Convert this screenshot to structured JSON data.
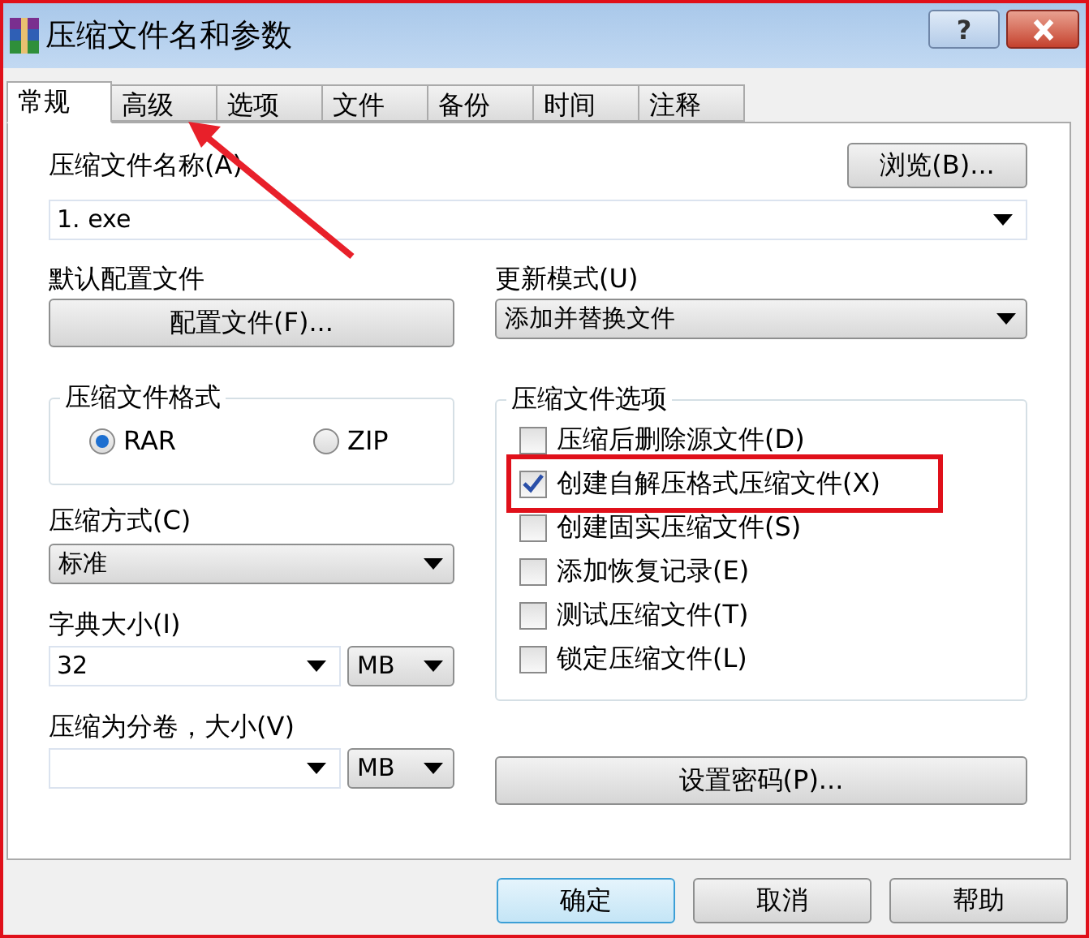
{
  "window": {
    "title": "压缩文件名和参数",
    "help_button": "?"
  },
  "tabs": [
    {
      "label": "常规",
      "selected": true
    },
    {
      "label": "高级",
      "selected": false
    },
    {
      "label": "选项",
      "selected": false
    },
    {
      "label": "文件",
      "selected": false
    },
    {
      "label": "备份",
      "selected": false
    },
    {
      "label": "时间",
      "selected": false
    },
    {
      "label": "注释",
      "selected": false
    }
  ],
  "archive_name": {
    "label": "压缩文件名称(A)",
    "value": "1. exe",
    "browse_button": "浏览(B)..."
  },
  "profiles": {
    "label": "默认配置文件",
    "button": "配置文件(F)..."
  },
  "update_mode": {
    "label": "更新模式(U)",
    "value": "添加并替换文件"
  },
  "archive_format": {
    "title": "压缩文件格式",
    "options": [
      {
        "label": "RAR",
        "selected": true
      },
      {
        "label": "ZIP",
        "selected": false
      }
    ]
  },
  "compression_method": {
    "label": "压缩方式(C)",
    "value": "标准"
  },
  "dictionary_size": {
    "label": "字典大小(I)",
    "value": "32",
    "unit": "MB"
  },
  "split_volumes": {
    "label": "压缩为分卷，大小(V)",
    "unit": "MB"
  },
  "archive_options": {
    "title": "压缩文件选项",
    "options": [
      {
        "label": "压缩后删除源文件(D)",
        "checked": false,
        "highlighted": false
      },
      {
        "label": "创建自解压格式压缩文件(X)",
        "checked": true,
        "highlighted": true
      },
      {
        "label": "创建固实压缩文件(S)",
        "checked": false,
        "highlighted": false
      },
      {
        "label": "添加恢复记录(E)",
        "checked": false,
        "highlighted": false
      },
      {
        "label": "测试压缩文件(T)",
        "checked": false,
        "highlighted": false
      },
      {
        "label": "锁定压缩文件(L)",
        "checked": false,
        "highlighted": false
      }
    ]
  },
  "password_button": "设置密码(P)...",
  "buttons": [
    {
      "label": "确定",
      "default": true
    },
    {
      "label": "取消",
      "default": false
    },
    {
      "label": "帮助",
      "default": false
    }
  ]
}
